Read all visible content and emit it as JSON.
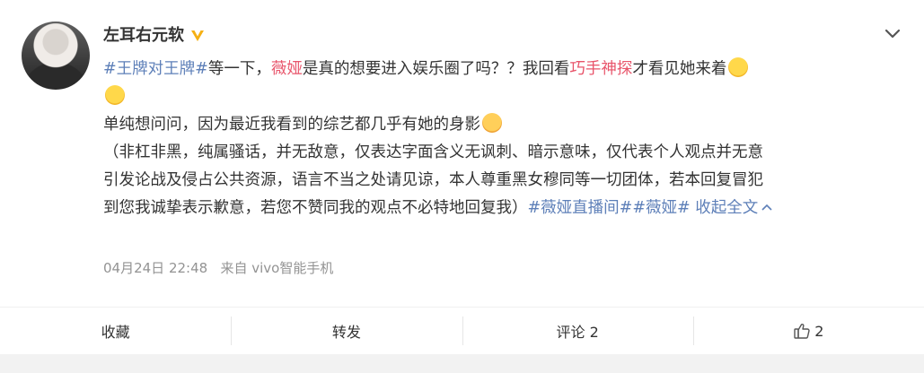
{
  "post": {
    "username": "左耳右元软",
    "line1": {
      "topic1": "#王牌对王牌#",
      "text1": "等一下，",
      "name1": "薇娅",
      "text2": "是真的想要进入娱乐圈了吗？？我回看",
      "name2": "巧手神探",
      "text3": "才看见她来着"
    },
    "line3": "单纯想问问，因为最近我看到的综艺都几乎有她的身影",
    "line4": "（非杠非黑，纯属骚话，并无敌意，仅表达字面含义无讽刺、暗示意味，仅代表个人观点并无意",
    "line5": "引发论战及侵占公共资源，语言不当之处请见谅，本人尊重黑女穆同等一切团体，若本回复冒犯",
    "line6": {
      "text": "到您我诚挚表示歉意，若您不赞同我的观点不必特地回复我）",
      "topic2": "#薇娅直播间#",
      "topic3": "#薇娅#",
      "collapse": "收起全文"
    },
    "timestamp": "04月24日 22:48",
    "source": "来自 vivo智能手机"
  },
  "actions": {
    "collect": "收藏",
    "repost": "转发",
    "comment": "评论 2",
    "like_count": "2"
  },
  "icons": {
    "verify": "verified-v-icon",
    "menu": "chevron-down-icon",
    "like": "thumbs-up-icon",
    "emoji_laugh": "laugh-cry-emoji",
    "emoji_drool": "drool-emoji"
  },
  "colors": {
    "topic": "#5d7fb8",
    "highlight": "#e8546a",
    "meta": "#939393",
    "verify": "#f5b013"
  }
}
